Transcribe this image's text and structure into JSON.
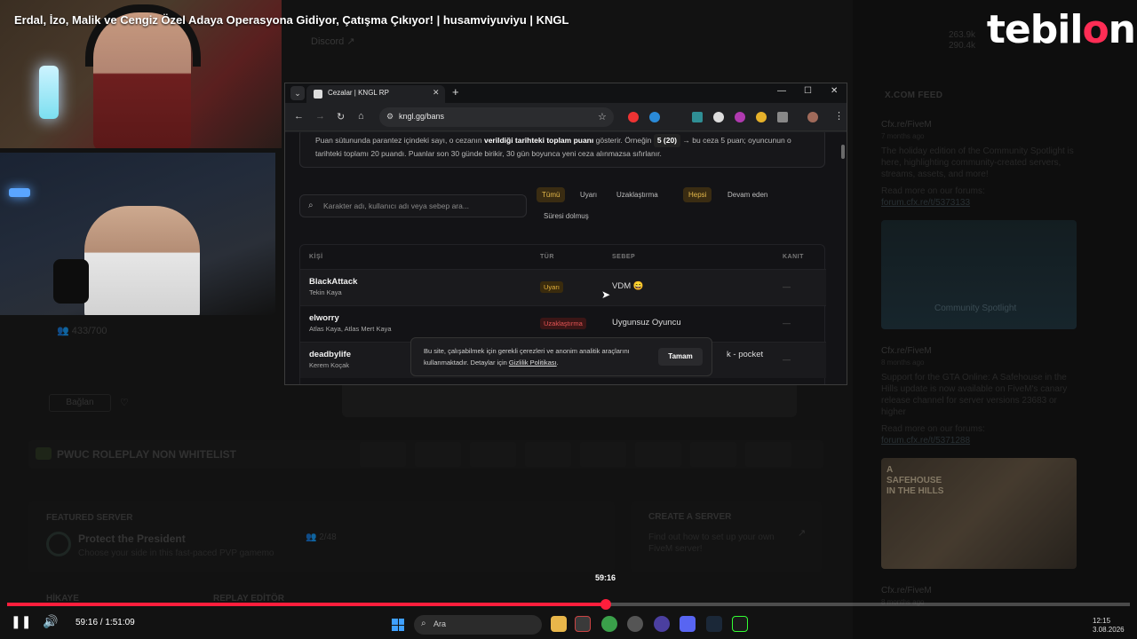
{
  "video": {
    "title": "Erdal, İzo, Malik ve Cengiz Özel Adaya Operasyona Gidiyor, Çatışma Çıkıyor! | husamviyuviyu | KNGL",
    "logo_pre": "tebil",
    "logo_o": "o",
    "logo_post": "n",
    "time_tooltip": "59:16",
    "time_display": "59:16 / 1:51:09",
    "progress_fraction": 0.533
  },
  "background_page": {
    "discord_label": "Discord",
    "stats_top": "263.9k",
    "stats_bottom": "290.4k",
    "players": "433/700",
    "connect_label": "Bağlan",
    "server_name": "PWUC ROLEPLAY NON WHITELIST",
    "featured_label": "FEATURED SERVER",
    "featured_name": "Protect the President",
    "featured_desc": "Choose your side in this fast-paced PVP gamemo",
    "featured_count": "2/48",
    "create_label": "CREATE A SERVER",
    "create_desc": "Find out how to set up your own FiveM server!",
    "hikaye": "HİKAYE",
    "replay": "REPLAY EDİTÖR",
    "feed_title": "X.COM FEED",
    "feed": [
      {
        "author": "Cfx.re/FiveM",
        "date": "7 months ago",
        "text": "The holiday edition of the Community Spotlight is here, highlighting community-created servers, streams, assets, and more!",
        "more": "Read more on our forums:",
        "link": "forum.cfx.re/t/5373133"
      },
      {
        "author": "Cfx.re/FiveM",
        "date": "8 months ago",
        "text": "Support for the GTA Online: A Safehouse in the Hills update is now available on FiveM's canary release channel for server versions 23683 or higher",
        "more": "Read more on our forums:",
        "link": "forum.cfx.re/t/5371288"
      },
      {
        "author": "Cfx.re/FiveM",
        "date": "8 months ago"
      }
    ],
    "feed_image1_caption": "Community Spotlight",
    "feed_image2_caption": "A SAFEHOUSE IN THE HILLS"
  },
  "browser": {
    "tab_title": "Cezalar | KNGL RP",
    "url": "kngl.gg/bans",
    "info_text_pre": "Puan sütununda parantez içindeki sayı, o cezanın ",
    "info_text_bold": "verildiği tarihteki toplam puanı",
    "info_text_mid": " gösterir. Örneğin ",
    "info_text_pill": "5 (20)",
    "info_text_post": " → bu ceza 5 puan; oyuncunun o tarihteki toplamı 20 puandı. Puanlar son 30 günde birikir, 30 gün boyunca yeni ceza alınmazsa sıfırlanır.",
    "search_placeholder": "Karakter adı, kullanıcı adı veya sebep ara...",
    "filters_type": [
      "Tümü",
      "Uyarı",
      "Uzaklaştırma"
    ],
    "filters_status": [
      "Hepsi",
      "Devam eden",
      "Süresi dolmuş"
    ],
    "columns": [
      "KİŞİ",
      "TÜR",
      "SEBEP",
      "KANIT"
    ],
    "rows": [
      {
        "name": "BlackAttack",
        "sub": "Tekin Kaya",
        "type": "Uyarı",
        "reason": "VDM 😄",
        "proof": "—"
      },
      {
        "name": "elworry",
        "sub": "Atlas Kaya, Atlas Mert Kaya",
        "type": "Uzaklaştırma",
        "reason": "Uygunsuz Oyuncu",
        "proof": "—"
      },
      {
        "name": "deadbylife",
        "sub": "Kerem Koçak",
        "type": "",
        "reason": "k - pocket",
        "proof": "—"
      }
    ],
    "cookie_text": "Bu site, çalışabilmek için gerekli çerezleri ve anonim analitik araçlarını kullanmaktadır. Detaylar için ",
    "cookie_link": "Gizlilik Politikası",
    "cookie_end": ".",
    "cookie_button": "Tamam"
  },
  "taskbar": {
    "search_label": "Ara",
    "clock_time": "12:15",
    "clock_date": "3.08.2026"
  }
}
